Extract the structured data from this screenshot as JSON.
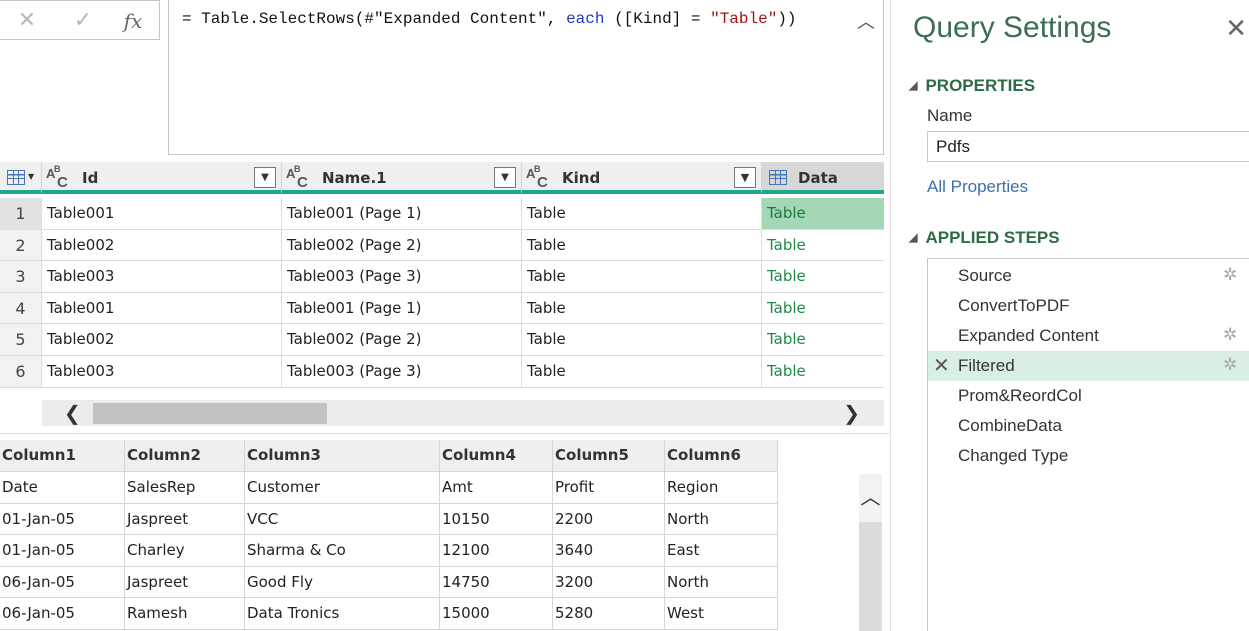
{
  "formula_bar": {
    "cancel_icon": "x-icon",
    "confirm_icon": "check-icon",
    "fx_label": "fx",
    "formula_prefix": "= Table.SelectRows(#\"Expanded Content\", ",
    "formula_keyword": "each",
    "formula_mid": " ([Kind] = ",
    "formula_string": "\"Table\"",
    "formula_suffix": "))",
    "collapse_icon": "chevron-up-icon"
  },
  "grid": {
    "columns": [
      {
        "name": "Id",
        "type_icon": "abc-text-icon",
        "filter_icon": "dropdown-icon"
      },
      {
        "name": "Name.1",
        "type_icon": "abc-text-icon",
        "filter_icon": "dropdown-icon"
      },
      {
        "name": "Kind",
        "type_icon": "abc-text-icon",
        "filter_icon": "filter-active-icon"
      },
      {
        "name": "Data",
        "type_icon": "table-icon"
      }
    ],
    "rows": [
      {
        "num": "1",
        "id": "Table001",
        "name": "Table001 (Page 1)",
        "kind": "Table",
        "data": "Table"
      },
      {
        "num": "2",
        "id": "Table002",
        "name": "Table002 (Page 2)",
        "kind": "Table",
        "data": "Table"
      },
      {
        "num": "3",
        "id": "Table003",
        "name": "Table003 (Page 3)",
        "kind": "Table",
        "data": "Table"
      },
      {
        "num": "4",
        "id": "Table001",
        "name": "Table001 (Page 1)",
        "kind": "Table",
        "data": "Table"
      },
      {
        "num": "5",
        "id": "Table002",
        "name": "Table002 (Page 2)",
        "kind": "Table",
        "data": "Table"
      },
      {
        "num": "6",
        "id": "Table003",
        "name": "Table003 (Page 3)",
        "kind": "Table",
        "data": "Table"
      }
    ],
    "selected_row": 1,
    "link_color": "#1e8a45",
    "accent_color": "#21a68c"
  },
  "preview": {
    "headers": [
      "Column1",
      "Column2",
      "Column3",
      "Column4",
      "Column5",
      "Column6"
    ],
    "rows": [
      [
        "Date",
        "SalesRep",
        "Customer",
        "Amt",
        "Profit",
        "Region"
      ],
      [
        "01-Jan-05",
        "Jaspreet",
        "VCC",
        "10150",
        "2200",
        "North"
      ],
      [
        "01-Jan-05",
        "Charley",
        "Sharma & Co",
        "12100",
        "3640",
        "East"
      ],
      [
        "06-Jan-05",
        "Jaspreet",
        "Good Fly",
        "14750",
        "3200",
        "North"
      ],
      [
        "06-Jan-05",
        "Ramesh",
        "Data Tronics",
        "15000",
        "5280",
        "West"
      ]
    ]
  },
  "query_settings": {
    "title": "Query Settings",
    "close_icon": "close-icon",
    "properties_heading": "PROPERTIES",
    "name_label": "Name",
    "name_value": "Pdfs",
    "all_properties_link": "All Properties",
    "applied_steps_heading": "APPLIED STEPS",
    "steps": [
      {
        "label": "Source",
        "gear": true
      },
      {
        "label": "ConvertToPDF",
        "gear": false
      },
      {
        "label": "Expanded Content",
        "gear": true
      },
      {
        "label": "Filtered",
        "gear": true,
        "selected": true
      },
      {
        "label": "Prom&ReordCol",
        "gear": false
      },
      {
        "label": "CombineData",
        "gear": false
      },
      {
        "label": "Changed Type",
        "gear": false
      }
    ],
    "title_color": "#3c6f52",
    "heading_color": "#2e6b47"
  }
}
